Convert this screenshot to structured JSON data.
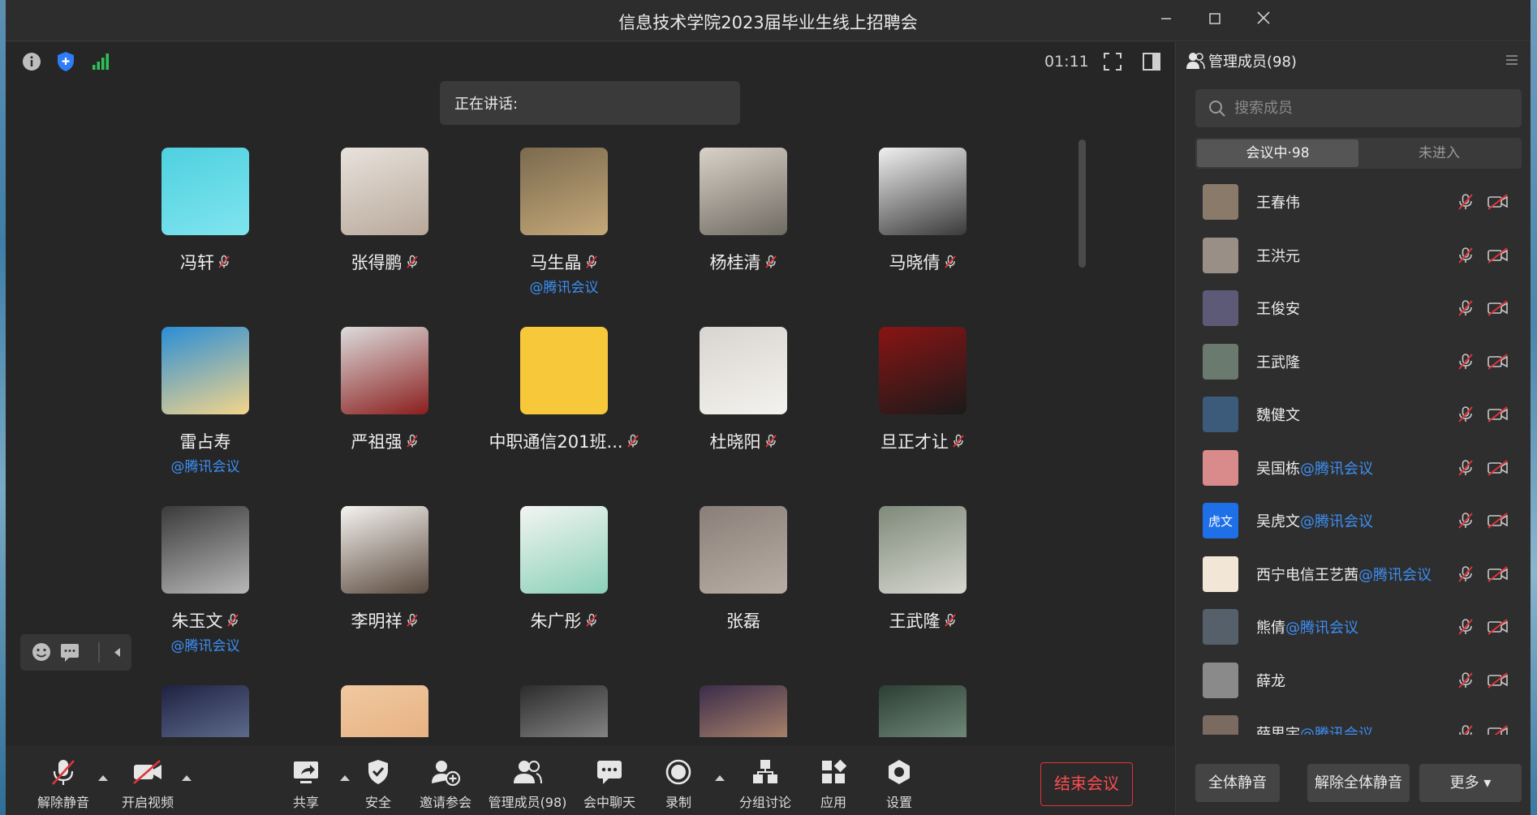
{
  "window": {
    "title": "信息技术学院2023届毕业生线上招聘会",
    "minimize_icon": "minimize-icon",
    "maximize_icon": "maximize-icon",
    "close_icon": "close-icon"
  },
  "stage": {
    "timer": "01:11",
    "speaking_label": "正在讲话:",
    "top_icons": [
      "info-icon",
      "shield-icon",
      "signal-icon"
    ],
    "right_icons": [
      "fullscreen-icon",
      "layout-icon"
    ]
  },
  "participants": [
    {
      "name": "冯轩",
      "tag": "",
      "muted": true
    },
    {
      "name": "张得鹏",
      "tag": "",
      "muted": true
    },
    {
      "name": "马生晶",
      "tag": "@腾讯会议",
      "muted": true
    },
    {
      "name": "杨桂清",
      "tag": "",
      "muted": true
    },
    {
      "name": "马晓倩",
      "tag": "",
      "muted": true
    },
    {
      "name": "雷占寿",
      "tag": "@腾讯会议",
      "muted": false
    },
    {
      "name": "严祖强",
      "tag": "",
      "muted": true
    },
    {
      "name": "中职通信201班...",
      "tag": "",
      "muted": true
    },
    {
      "name": "杜晓阳",
      "tag": "",
      "muted": true
    },
    {
      "name": "旦正才让",
      "tag": "",
      "muted": true
    },
    {
      "name": "朱玉文",
      "tag": "@腾讯会议",
      "muted": true
    },
    {
      "name": "李明祥",
      "tag": "",
      "muted": true
    },
    {
      "name": "朱广彤",
      "tag": "",
      "muted": true
    },
    {
      "name": "张磊",
      "tag": "",
      "muted": false
    },
    {
      "name": "王武隆",
      "tag": "",
      "muted": true
    },
    {
      "name": "",
      "tag": "",
      "muted": false
    },
    {
      "name": "",
      "tag": "",
      "muted": false
    },
    {
      "name": "",
      "tag": "",
      "muted": false
    },
    {
      "name": "",
      "tag": "",
      "muted": false
    },
    {
      "name": "",
      "tag": "",
      "muted": false
    }
  ],
  "toolbar": {
    "unmute": "解除静音",
    "video": "开启视频",
    "share": "共享",
    "security": "安全",
    "invite": "邀请参会",
    "members": "管理成员(98)",
    "chat": "会中聊天",
    "record": "录制",
    "breakout": "分组讨论",
    "apps": "应用",
    "settings": "设置",
    "end": "结束会议"
  },
  "panel": {
    "title": "管理成员(98)",
    "search_placeholder": "搜索成员",
    "tab_in_meeting": "会议中·98",
    "tab_not_joined": "未进入",
    "members": [
      {
        "name": "王春伟",
        "at": ""
      },
      {
        "name": "王洪元",
        "at": ""
      },
      {
        "name": "王俊安",
        "at": ""
      },
      {
        "name": "王武隆",
        "at": ""
      },
      {
        "name": "魏健文",
        "at": ""
      },
      {
        "name": "吴国栋",
        "at": "@腾讯会议"
      },
      {
        "name": "吴虎文",
        "at": "@腾讯会议",
        "avatar_text": "虎文"
      },
      {
        "name": "西宁电信王艺茜",
        "at": "@腾讯会议"
      },
      {
        "name": "熊倩",
        "at": "@腾讯会议"
      },
      {
        "name": "薛龙",
        "at": ""
      },
      {
        "name": "薛思宇",
        "at": "@腾讯会议"
      }
    ],
    "mute_all": "全体静音",
    "unmute_all": "解除全体静音",
    "more": "更多 ▾"
  },
  "colors": {
    "accent_blue": "#3d8ff5",
    "end_red": "#e0343a",
    "background": "#2a2a2a"
  }
}
